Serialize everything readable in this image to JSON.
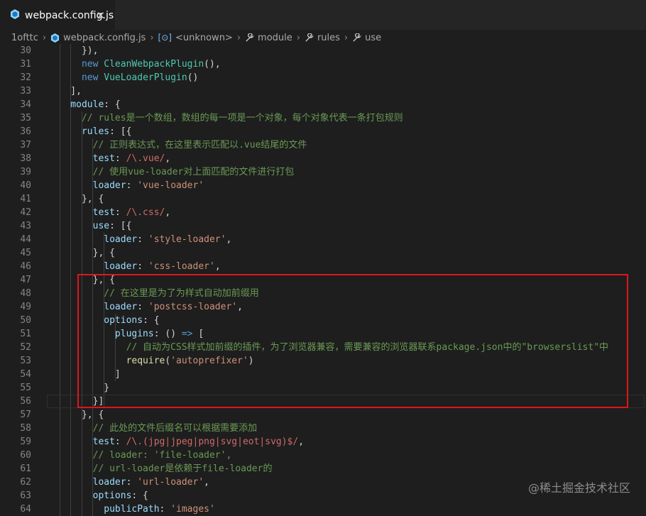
{
  "tab": {
    "title": "webpack.config.js",
    "close_glyph": "✕"
  },
  "breadcrumb": [
    "1ofttc",
    "webpack.config.js",
    "<unknown>",
    "module",
    "rules",
    "use"
  ],
  "colors": {
    "accent_box": "#e0151b",
    "background": "#1e1e1e"
  },
  "code_lines": [
    {
      "n": "30",
      "segs": [
        [
          "punc",
          "      }),"
        ]
      ]
    },
    {
      "n": "31",
      "segs": [
        [
          "kw",
          "      new "
        ],
        [
          "cls",
          "CleanWebpackPlugin"
        ],
        [
          "punc",
          "(),"
        ]
      ]
    },
    {
      "n": "32",
      "segs": [
        [
          "kw",
          "      new "
        ],
        [
          "cls",
          "VueLoaderPlugin"
        ],
        [
          "punc",
          "()"
        ]
      ]
    },
    {
      "n": "33",
      "segs": [
        [
          "punc",
          "    ],"
        ]
      ]
    },
    {
      "n": "34",
      "segs": [
        [
          "prop",
          "    module"
        ],
        [
          "punc",
          ": {"
        ]
      ]
    },
    {
      "n": "35",
      "segs": [
        [
          "com",
          "      // rules是一个数组，数组的每一项是一个对象，每个对象代表一条打包规则"
        ]
      ]
    },
    {
      "n": "36",
      "segs": [
        [
          "prop",
          "      rules"
        ],
        [
          "punc",
          ": [{"
        ]
      ]
    },
    {
      "n": "37",
      "segs": [
        [
          "com",
          "        // 正则表达式，在这里表示匹配以.vue结尾的文件"
        ]
      ]
    },
    {
      "n": "38",
      "segs": [
        [
          "prop",
          "        test"
        ],
        [
          "punc",
          ": "
        ],
        [
          "re",
          "/\\.vue/"
        ],
        [
          "punc",
          ","
        ]
      ]
    },
    {
      "n": "39",
      "segs": [
        [
          "com",
          "        // 使用vue-loader对上面匹配的文件进行打包"
        ]
      ]
    },
    {
      "n": "40",
      "segs": [
        [
          "prop",
          "        loader"
        ],
        [
          "punc",
          ": "
        ],
        [
          "str",
          "'vue-loader'"
        ]
      ]
    },
    {
      "n": "41",
      "segs": [
        [
          "punc",
          "      }, {"
        ]
      ]
    },
    {
      "n": "42",
      "segs": [
        [
          "prop",
          "        test"
        ],
        [
          "punc",
          ": "
        ],
        [
          "re",
          "/\\.css/"
        ],
        [
          "punc",
          ","
        ]
      ]
    },
    {
      "n": "43",
      "segs": [
        [
          "prop",
          "        use"
        ],
        [
          "punc",
          ": [{"
        ]
      ]
    },
    {
      "n": "44",
      "segs": [
        [
          "prop",
          "          loader"
        ],
        [
          "punc",
          ": "
        ],
        [
          "str",
          "'style-loader'"
        ],
        [
          "punc",
          ","
        ]
      ]
    },
    {
      "n": "45",
      "segs": [
        [
          "punc",
          "        }, {"
        ]
      ]
    },
    {
      "n": "46",
      "segs": [
        [
          "prop",
          "          loader"
        ],
        [
          "punc",
          ": "
        ],
        [
          "str",
          "'css-loader'"
        ],
        [
          "punc",
          ","
        ]
      ]
    },
    {
      "n": "47",
      "segs": [
        [
          "punc",
          "        }, {"
        ]
      ]
    },
    {
      "n": "48",
      "segs": [
        [
          "com",
          "          // 在这里是为了为样式自动加前缀用"
        ]
      ]
    },
    {
      "n": "49",
      "segs": [
        [
          "prop",
          "          loader"
        ],
        [
          "punc",
          ": "
        ],
        [
          "str",
          "'postcss-loader'"
        ],
        [
          "punc",
          ","
        ]
      ]
    },
    {
      "n": "50",
      "segs": [
        [
          "prop",
          "          options"
        ],
        [
          "punc",
          ": {"
        ]
      ]
    },
    {
      "n": "51",
      "segs": [
        [
          "prop",
          "            plugins"
        ],
        [
          "punc",
          ": () "
        ],
        [
          "kw",
          "=>"
        ],
        [
          "punc",
          " ["
        ]
      ]
    },
    {
      "n": "52",
      "segs": [
        [
          "com",
          "              // 自动为CSS样式加前缀的插件，为了浏览器兼容，需要兼容的浏览器联系package.json中的\"browserslist\"中"
        ]
      ]
    },
    {
      "n": "53",
      "segs": [
        [
          "fn",
          "              require"
        ],
        [
          "punc",
          "("
        ],
        [
          "str",
          "'autoprefixer'"
        ],
        [
          "punc",
          ")"
        ]
      ]
    },
    {
      "n": "54",
      "segs": [
        [
          "punc",
          "            ]"
        ]
      ]
    },
    {
      "n": "55",
      "segs": [
        [
          "punc",
          "          }"
        ]
      ]
    },
    {
      "n": "56",
      "segs": [
        [
          "punc",
          "        }]"
        ]
      ]
    },
    {
      "n": "57",
      "segs": [
        [
          "punc",
          "      }, {"
        ]
      ]
    },
    {
      "n": "58",
      "segs": [
        [
          "com",
          "        // 此处的文件后缀名可以根据需要添加"
        ]
      ]
    },
    {
      "n": "59",
      "segs": [
        [
          "prop",
          "        test"
        ],
        [
          "punc",
          ": "
        ],
        [
          "re",
          "/\\.(jpg|jpeg|png|svg|eot|svg)$/"
        ],
        [
          "punc",
          ","
        ]
      ]
    },
    {
      "n": "60",
      "segs": [
        [
          "com",
          "        // loader: 'file-loader',"
        ]
      ]
    },
    {
      "n": "61",
      "segs": [
        [
          "com",
          "        // url-loader是依赖于file-loader的"
        ]
      ]
    },
    {
      "n": "62",
      "segs": [
        [
          "prop",
          "        loader"
        ],
        [
          "punc",
          ": "
        ],
        [
          "str",
          "'url-loader'"
        ],
        [
          "punc",
          ","
        ]
      ]
    },
    {
      "n": "63",
      "segs": [
        [
          "prop",
          "        options"
        ],
        [
          "punc",
          ": {"
        ]
      ]
    },
    {
      "n": "64",
      "segs": [
        [
          "prop",
          "          publicPath"
        ],
        [
          "punc",
          ": "
        ],
        [
          "str",
          "'images'"
        ]
      ]
    }
  ],
  "watermark": "@稀土掘金技术社区"
}
